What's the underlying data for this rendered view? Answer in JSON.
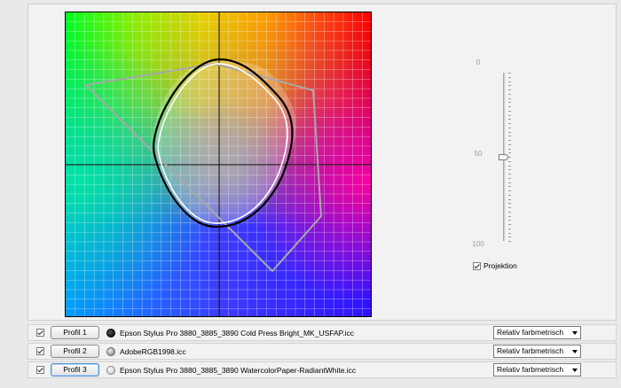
{
  "slider": {
    "labels": [
      "0",
      "50",
      "100"
    ],
    "value": 50
  },
  "projection": {
    "label": "Projektion",
    "checked": true
  },
  "profiles": [
    {
      "button_label": "Profil 1",
      "enabled": true,
      "file": "Epson Stylus Pro 3880_3885_3890 Cold Press Bright_MK_USFAP.icc",
      "intent": "Relativ farbmetrisch",
      "swatch": "black",
      "focused": false
    },
    {
      "button_label": "Profil 2",
      "enabled": true,
      "file": "AdobeRGB1998.icc",
      "intent": "Relativ farbmetrisch",
      "swatch": "gray",
      "focused": false
    },
    {
      "button_label": "Profil 3",
      "enabled": true,
      "file": "Epson Stylus Pro 3880_3885_3890 WatercolorPaper-RadiantWhite.icc",
      "intent": "Relativ farbmetrisch",
      "swatch": "white",
      "focused": true
    }
  ],
  "colors": {
    "accent": "#4a8fd6",
    "gamut_1": "#000000",
    "gamut_2": "#a8a8a8",
    "gamut_3": "#ffffff"
  }
}
